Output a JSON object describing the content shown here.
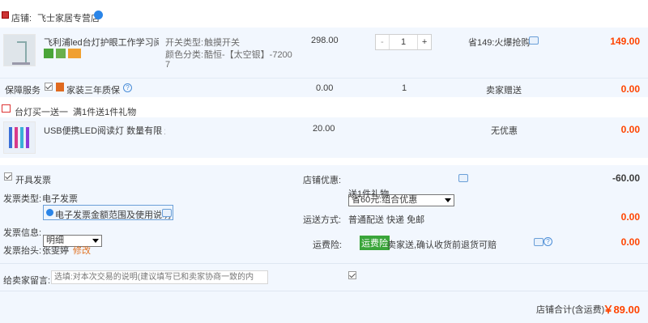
{
  "shop": {
    "label": "店铺:",
    "name": "飞士家居专营店"
  },
  "item1": {
    "title": "飞利浦led台灯护眼工作学习阅读...",
    "spec1_label": "开关类型:",
    "spec1_value": "触摸开关",
    "spec2_label": "颜色分类:",
    "spec2_value": "酷恒-【太空银】-7200",
    "spec2_cont": "7",
    "price": "298.00",
    "qty": "1",
    "qty_minus": "-",
    "qty_plus": "+",
    "promo": "省149:火爆抢购",
    "total": "149.00"
  },
  "service": {
    "label": "保障服务",
    "name": "家装三年质保",
    "price": "0.00",
    "qty": "1",
    "delivery": "卖家赠送",
    "total": "0.00"
  },
  "gift_promo": {
    "title": "台灯买一送一",
    "rule": "满1件送1件礼物"
  },
  "item2": {
    "title": "USB便携LED阅读灯 数量有限 送...",
    "price": "20.00",
    "promo": "无优惠",
    "total": "0.00"
  },
  "invoice": {
    "open_label": "开具发票",
    "type_label": "发票类型:",
    "type_value": "电子发票",
    "help_link": "电子发票金额范围及使用说明",
    "info_label": "发票信息:",
    "info_value": "明细",
    "header_label": "发票抬头:",
    "header_value": "张雯婷",
    "edit_link": "修改"
  },
  "shop_discount": {
    "label": "店铺优惠:",
    "selected": "省60元:组合优惠",
    "gift_text": "送1件礼物",
    "total": "-60.00"
  },
  "shipping": {
    "label": "运送方式:",
    "value": "普通配送 快递 免邮",
    "total": "0.00"
  },
  "insurance": {
    "label": "运费险:",
    "badge": "运费险",
    "text": "卖家送,确认收货前退货可赔",
    "total": "0.00"
  },
  "message": {
    "label": "给卖家留言:",
    "placeholder": "选填:对本次交易的说明(建议填写已和卖家协商一致的内"
  },
  "footer": {
    "label": "店铺合计(含运费)",
    "total": "￥89.00"
  },
  "colors": {
    "price": "#ff4400",
    "link": "#3366cc",
    "badge": "#3aa53a",
    "panel": "#f2f7fe"
  }
}
